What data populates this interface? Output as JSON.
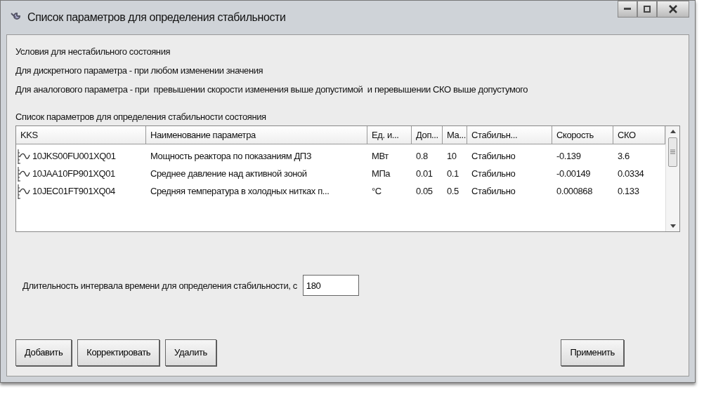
{
  "window": {
    "title": "Список параметров для определения стабильности"
  },
  "conditions": [
    "Условия для нестабильного состояния",
    "Для дискретного параметра - при любом изменении значения",
    "Для аналогового параметра - при  превышении скорости изменения выше допустимой  и перевышении СКО выше допустумого"
  ],
  "list_label": "Список параметров для определения стабильности состояния",
  "table": {
    "columns": [
      "KKS",
      "Наименование параметра",
      "Ед. и...",
      "Доп...",
      "Ма...",
      "Стабильн...",
      "Скорость",
      "СКО"
    ],
    "rows": [
      {
        "cells": [
          "10JKS00FU001XQ01",
          "Мощность реактора по показаниям ДПЗ",
          "МВт",
          "0.8",
          "10",
          "Стабильно",
          "-0.139",
          "3.6"
        ]
      },
      {
        "cells": [
          "10JAA10FP901XQ01",
          "Среднее давление над активной зоной",
          "МПа",
          "0.01",
          "0.1",
          "Стабильно",
          "-0.00149",
          "0.0334"
        ]
      },
      {
        "cells": [
          "10JEC01FT901XQ04",
          "Средняя температура в холодных нитках п...",
          "°С",
          "0.05",
          "0.5",
          "Стабильно",
          "0.000868",
          "0.133"
        ]
      }
    ]
  },
  "interval": {
    "label": "Длительность интервала времени для определения стабильности, с",
    "value": "180"
  },
  "buttons_left": [
    "Добавить",
    "Корректировать",
    "Удалить"
  ],
  "buttons_right": [
    "Применить"
  ]
}
